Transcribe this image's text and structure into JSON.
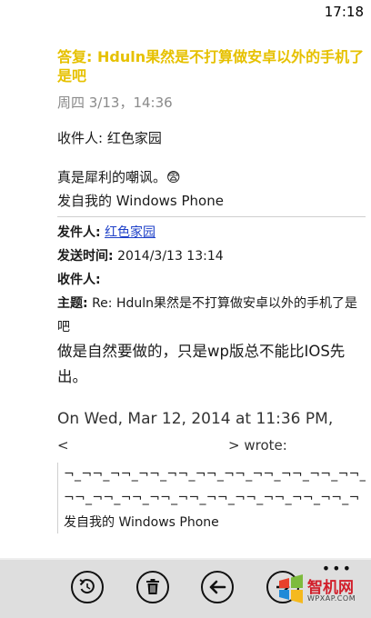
{
  "status_bar": {
    "time": "17:18"
  },
  "message": {
    "subject": "答复: Hduln果然是不打算做安卓以外的手机了是吧",
    "date": "周四 3/13，14:36",
    "recipient": "收件人: 红色家园",
    "body": [
      "真是犀利的嘲讽。😨",
      "发自我的 Windows Phone"
    ]
  },
  "quoted_header": {
    "from_label": "发件人:",
    "from_name": "红色家园",
    "sent_label": "发送时间:",
    "sent_value": "2014/3/13 13:14",
    "to_label": "收件人:",
    "subject_label": "主题:",
    "subject_value": "Re: Hduln果然是不打算做安卓以外的手机了是吧"
  },
  "quoted_body": "做是自然要做的，只是wp版总不能比IOS先出。",
  "earlier": {
    "on_line": "On Wed, Mar 12, 2014 at 11:36 PM,",
    "lt": "<",
    "wrote": "> wrote:",
    "tilde_line_1": "¬_¬¬_¬¬_¬¬_¬¬_¬¬_¬¬_¬¬_¬¬_¬¬_¬¬_¬¬_¬¬_",
    "tilde_line_2": "¬¬_¬¬_¬¬_¬¬_¬¬_¬¬_¬¬_¬¬_¬¬_¬¬_¬",
    "signature": "发自我的 Windows Phone"
  },
  "app_bar": {
    "buttons": [
      {
        "icon": "reply-icon"
      },
      {
        "icon": "delete-icon"
      },
      {
        "icon": "back-arrow-icon"
      },
      {
        "icon": "forward-icon"
      }
    ],
    "more": "•••"
  },
  "watermark": {
    "name": "智机网",
    "url": "WPXAP.COM"
  }
}
